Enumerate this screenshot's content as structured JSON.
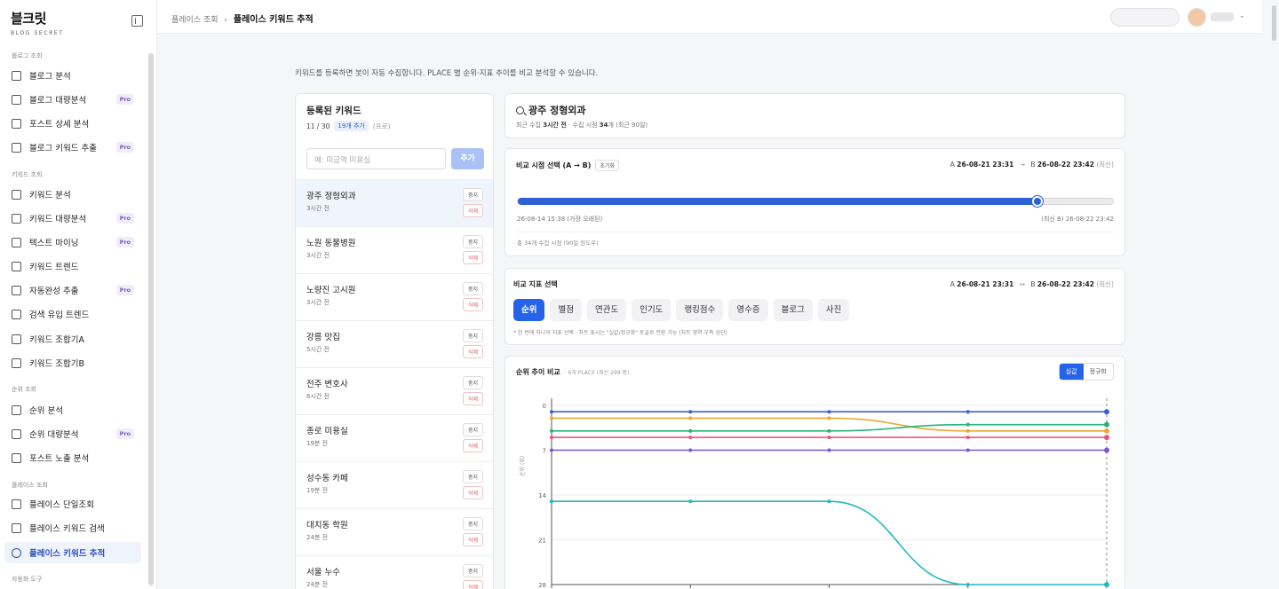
{
  "brand": {
    "name": "블크릿",
    "sub": "BLOG SECRET"
  },
  "sidebar": {
    "groups": [
      {
        "label": "블로그 조회"
      },
      {
        "label": "키워드 조회"
      },
      {
        "label": "순위 조회"
      },
      {
        "label": "플레이스 조회"
      },
      {
        "label": "자동화 도구"
      }
    ],
    "items": [
      {
        "label": "블로그 분석",
        "pro": false,
        "icon": "document-icon"
      },
      {
        "label": "블로그 대량분석",
        "pro": true,
        "icon": "clipboard-icon"
      },
      {
        "label": "포스트 상세 분석",
        "pro": false,
        "icon": "copy-icon"
      },
      {
        "label": "블로그 키워드 추출",
        "pro": true,
        "icon": "tag-icon"
      },
      {
        "label": "키워드 분석",
        "pro": false,
        "icon": "search-icon"
      },
      {
        "label": "키워드 대량분석",
        "pro": true,
        "icon": "filter-icon"
      },
      {
        "label": "텍스트 마이닝",
        "pro": true,
        "icon": "text-mining-icon"
      },
      {
        "label": "키워드 트렌드",
        "pro": false,
        "icon": "line-chart-icon"
      },
      {
        "label": "자동완성 추출",
        "pro": true,
        "icon": "magic-wand-icon"
      },
      {
        "label": "검색 유입 트렌드",
        "pro": false,
        "icon": "download-icon"
      },
      {
        "label": "키워드 조합기A",
        "pro": false,
        "icon": "grid-icon"
      },
      {
        "label": "키워드 조합기B",
        "pro": false,
        "icon": "grid-plus-icon"
      },
      {
        "label": "순위 분석",
        "pro": false,
        "icon": "trend-up-icon"
      },
      {
        "label": "순위 대량분석",
        "pro": true,
        "icon": "bar-chart-icon"
      },
      {
        "label": "포스트 노출 분석",
        "pro": false,
        "icon": "eye-icon"
      },
      {
        "label": "플레이스 단일조회",
        "pro": false,
        "icon": "pin-icon"
      },
      {
        "label": "플레이스 키워드 검색",
        "pro": false,
        "icon": "user-search-icon"
      },
      {
        "label": "플레이스 키워드 추적",
        "pro": false,
        "icon": "target-icon"
      }
    ],
    "pro_label": "Pro"
  },
  "header": {
    "crumb_parent": "플레이스 조회",
    "crumb_sep": "›",
    "crumb_current": "플레이스 키워드 추적"
  },
  "intro": "키워드를 등록하면 봇이 자동 수집합니다. PLACE 별 순위·지표 추이를 비교 분석할 수 있습니다.",
  "keywords_panel": {
    "title": "등록된 키워드",
    "count": "11 / 30",
    "badge": "19개 추가",
    "tier": "(프로)",
    "placeholder": "예: 미금역 미용실",
    "add_label": "추가",
    "stop_label": "중지",
    "delete_label": "삭제",
    "items": [
      {
        "name": "광주 정형외과",
        "time": "3시간 전"
      },
      {
        "name": "노원 동물병원",
        "time": "3시간 전"
      },
      {
        "name": "노량진 고시원",
        "time": "3시간 전"
      },
      {
        "name": "강릉 맛집",
        "time": "5시간 전"
      },
      {
        "name": "전주 변호사",
        "time": "6시간 전"
      },
      {
        "name": "종로 미용실",
        "time": "19분 전"
      },
      {
        "name": "성수동 카페",
        "time": "19분 전"
      },
      {
        "name": "대치동 학원",
        "time": "24분 전"
      },
      {
        "name": "서울 누수",
        "time": "24분 전"
      }
    ]
  },
  "place_header": {
    "title": "광주 정형외과",
    "meta_prefix": "최근 수집",
    "meta_recent": "3시간 전",
    "meta_mid": "· 수집 시점",
    "meta_count": "34",
    "meta_suffix": "개 (최근 90일)"
  },
  "compare_time": {
    "title": "비교 시점 선택 (A → B)",
    "reset_label": "초기화",
    "a_prefix": "A",
    "a_value": "26-08-21 23:31",
    "arrow": "→",
    "b_prefix": "B",
    "b_value": "26-08-22 23:42",
    "b_tag": "(최신)",
    "slider_pos": 0.873,
    "left_label": "26-08-14 15:38 (가장 오래된)",
    "right_label": "(최신 B) 26-08-22 23:42",
    "note": "총 34개 수집 시점 (90일 윈도우)"
  },
  "metric": {
    "title": "비교 지표 선택",
    "a_prefix": "A",
    "a_value": "26-08-21 23:31",
    "arrow": "↔",
    "b_prefix": "B",
    "b_value": "26-08-22 23:42",
    "b_tag": "(최신)",
    "tabs": [
      "순위",
      "별점",
      "연관도",
      "인기도",
      "랭킹점수",
      "영수증",
      "블로그",
      "사진"
    ],
    "active_tab": 0,
    "note": "* 한 번에 하나의 지표 선택 · 차트 표시는 \"실값/정규화\" 토글로 전환 가능 (차트 영역 우측 상단)"
  },
  "chart_panel": {
    "title": "순위 추이 비교",
    "subtitle": "· 6개 PLACE (최신 299 중)",
    "seg_actual": "실값",
    "seg_norm": "정규화",
    "ylabel": "순위 (위)"
  },
  "chart_data": {
    "type": "line",
    "y_inverted": true,
    "ylim": [
      0,
      28
    ],
    "yticks": [
      "0",
      "7",
      "14",
      "21",
      "28"
    ],
    "ytick_values": [
      0,
      7,
      14,
      21,
      28
    ],
    "x": [
      0,
      1,
      2,
      3,
      4
    ],
    "series": [
      {
        "color": "#3b5fd9",
        "values": [
          1,
          1,
          1,
          1,
          1
        ]
      },
      {
        "color": "#e9a832",
        "values": [
          2,
          2,
          2,
          4,
          4
        ]
      },
      {
        "color": "#26b37a",
        "values": [
          4,
          4,
          4,
          3,
          3
        ]
      },
      {
        "color": "#e8577a",
        "values": [
          5,
          5,
          5,
          5,
          5
        ]
      },
      {
        "color": "#7c55d4",
        "values": [
          7,
          7,
          7,
          7,
          7
        ]
      },
      {
        "color": "#21b8c4",
        "values": [
          15,
          15,
          15,
          28,
          28
        ]
      }
    ]
  }
}
